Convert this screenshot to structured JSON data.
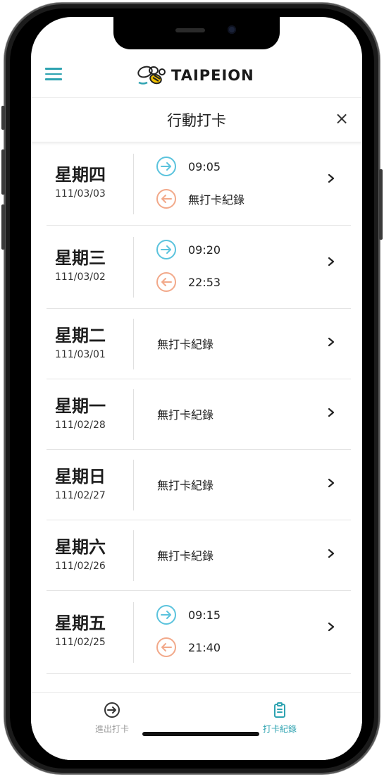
{
  "header": {
    "logo_text": "TAIPEION"
  },
  "page": {
    "title": "行動打卡",
    "close_symbol": "×"
  },
  "records": [
    {
      "day": "星期四",
      "date": "111/03/03",
      "in_time": "09:05",
      "out_time": "無打卡紀錄",
      "has_punch": true
    },
    {
      "day": "星期三",
      "date": "111/03/02",
      "in_time": "09:20",
      "out_time": "22:53",
      "has_punch": true
    },
    {
      "day": "星期二",
      "date": "111/03/01",
      "no_record": "無打卡紀錄",
      "has_punch": false
    },
    {
      "day": "星期一",
      "date": "111/02/28",
      "no_record": "無打卡紀錄",
      "has_punch": false
    },
    {
      "day": "星期日",
      "date": "111/02/27",
      "no_record": "無打卡紀錄",
      "has_punch": false
    },
    {
      "day": "星期六",
      "date": "111/02/26",
      "no_record": "無打卡紀錄",
      "has_punch": false
    },
    {
      "day": "星期五",
      "date": "111/02/25",
      "in_time": "09:15",
      "out_time": "21:40",
      "has_punch": true
    }
  ],
  "bottom_nav": {
    "checkin_label": "進出打卡",
    "records_label": "打卡紀錄"
  },
  "colors": {
    "accent": "#2ea3b1",
    "clock_in": "#5bc3dd",
    "clock_out": "#f2a98a"
  }
}
